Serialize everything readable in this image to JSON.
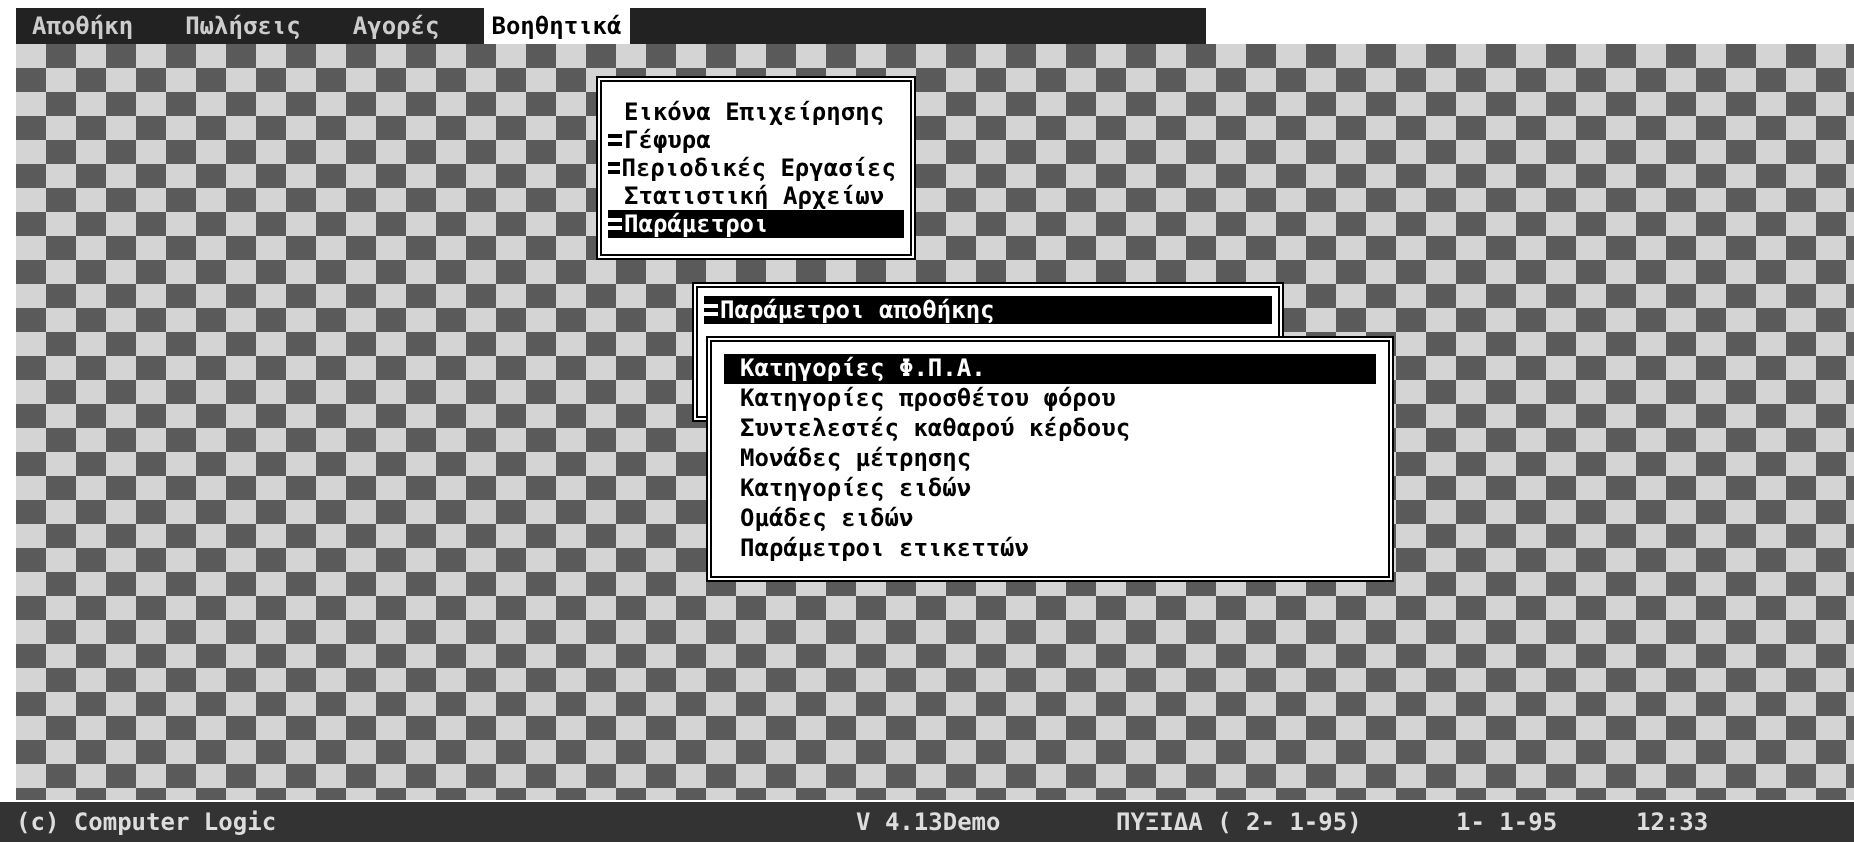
{
  "menu_bar": [
    {
      "label": "Αποθήκη",
      "selected": false
    },
    {
      "label": "Πωλήσεις",
      "selected": false
    },
    {
      "label": "Αγορές",
      "selected": false
    },
    {
      "label": "Βοηθητικά",
      "selected": true
    }
  ],
  "menus": [
    {
      "items": [
        {
          "label": "Εικόνα Επιχείρησης",
          "submenu": false,
          "selected": false
        },
        {
          "label": "Γέφυρα",
          "submenu": true,
          "selected": false
        },
        {
          "label": "Περιοδικές Εργασίες",
          "submenu": true,
          "selected": false
        },
        {
          "label": "Στατιστική Αρχείων",
          "submenu": false,
          "selected": false
        },
        {
          "label": "Παράμετροι",
          "submenu": true,
          "selected": true
        }
      ]
    },
    {
      "items": [
        {
          "label": "Παράμετροι αποθήκης",
          "submenu": true,
          "selected": true
        }
      ]
    },
    {
      "items": [
        {
          "label": "Κατηγορίες Φ.Π.Α.",
          "submenu": false,
          "selected": true
        },
        {
          "label": "Κατηγορίες προσθέτου φόρου",
          "submenu": false,
          "selected": false
        },
        {
          "label": "Συντελεστές καθαρού κέρδους",
          "submenu": false,
          "selected": false
        },
        {
          "label": "Μονάδες μέτρησης",
          "submenu": false,
          "selected": false
        },
        {
          "label": "Κατηγορίες ειδών",
          "submenu": false,
          "selected": false
        },
        {
          "label": "Ομάδες ειδών",
          "submenu": false,
          "selected": false
        },
        {
          "label": "Παράμετροι ετικεττών",
          "submenu": false,
          "selected": false
        }
      ]
    }
  ],
  "status_bar": {
    "copyright": "(c) Computer Logic",
    "version": "V 4.13Demo",
    "database": "ΠΥΞΙΔΑ ( 2- 1-95)",
    "date": "1- 1-95",
    "time": "12:33"
  }
}
